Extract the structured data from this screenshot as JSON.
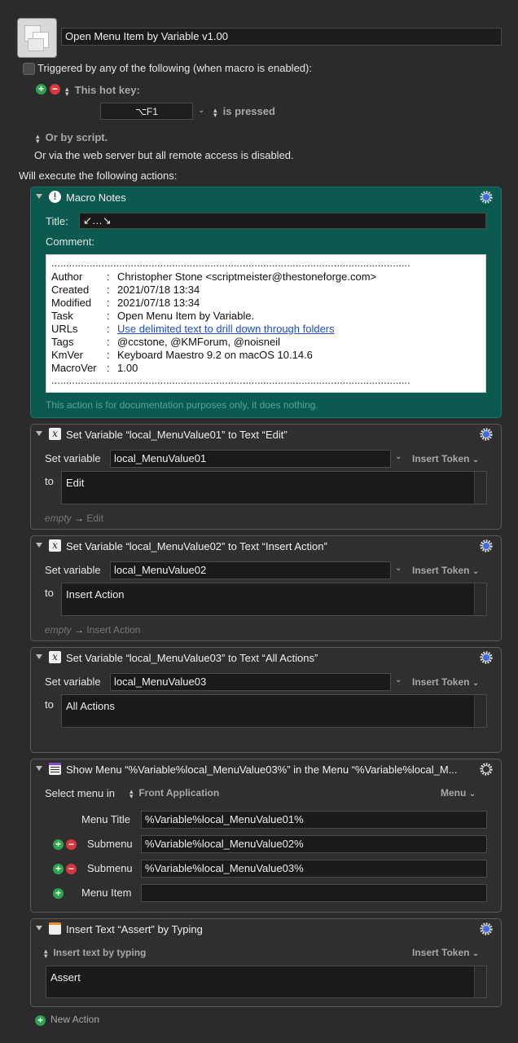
{
  "macro": {
    "name": "Open Menu Item by Variable v1.00",
    "trigger_checkbox_label": "Triggered by any of the following (when macro is enabled):",
    "hotkey_label": "This hot key:",
    "hotkey_value": "⌥F1",
    "hotkey_state": "is pressed",
    "or_by_script": "Or by script.",
    "web_server_note": "Or via the web server but all remote access is disabled.",
    "will_execute": "Will execute the following actions:",
    "new_action": "New Action"
  },
  "notes_action": {
    "title": "Macro Notes",
    "title_label": "Title:",
    "title_value": "↙…↘",
    "comment_label": "Comment:",
    "dots": "...............................................................................................................................................",
    "rows": [
      {
        "key": "Author",
        "value": "Christopher Stone <scriptmeister@thestoneforge.com>"
      },
      {
        "key": "Created",
        "value": "2021/07/18 13:34"
      },
      {
        "key": "Modified",
        "value": "2021/07/18 13:34"
      },
      {
        "key": "Task",
        "value": "Open Menu Item by Variable."
      },
      {
        "key": "URLs",
        "value": "Use delimited text to drill down through folders"
      },
      {
        "key": "Tags",
        "value": "@ccstone, @KMForum, @noisneil"
      },
      {
        "key": "KmVer",
        "value": "Keyboard Maestro 9.2 on macOS 10.14.6"
      },
      {
        "key": "MacroVer",
        "value": "1.00"
      }
    ],
    "footer": "This action is for documentation purposes only, it does nothing."
  },
  "set_var_actions": [
    {
      "title": "Set Variable “local_MenuValue01” to Text “Edit”",
      "set_label": "Set variable",
      "var_name": "local_MenuValue01",
      "insert_token": "Insert Token",
      "to_label": "to",
      "text": "Edit",
      "preview_empty": "empty",
      "preview_arrow": "→",
      "preview_value": "Edit"
    },
    {
      "title": "Set Variable “local_MenuValue02” to Text “Insert Action”",
      "set_label": "Set variable",
      "var_name": "local_MenuValue02",
      "insert_token": "Insert Token",
      "to_label": "to",
      "text": "Insert Action",
      "preview_empty": "empty",
      "preview_arrow": "→",
      "preview_value": "Insert Action"
    },
    {
      "title": "Set Variable “local_MenuValue03” to Text “All Actions”",
      "set_label": "Set variable",
      "var_name": "local_MenuValue03",
      "insert_token": "Insert Token",
      "to_label": "to",
      "text": "All Actions"
    }
  ],
  "show_menu_action": {
    "title": "Show Menu “%Variable%local_MenuValue03%” in the Menu “%Variable%local_M...",
    "select_label": "Select menu in",
    "app_value": "Front Application",
    "menu_popup": "Menu",
    "menu_title_label": "Menu Title",
    "menu_title_value": "%Variable%local_MenuValue01%",
    "submenu_label": "Submenu",
    "submenu1_value": "%Variable%local_MenuValue02%",
    "submenu2_value": "%Variable%local_MenuValue03%",
    "menu_item_label": "Menu Item",
    "menu_item_value": ""
  },
  "insert_text_action": {
    "title": "Insert Text “Assert” by Typing",
    "mode": "Insert text by typing",
    "insert_token": "Insert Token",
    "text": "Assert"
  },
  "colors": {
    "notes_bg": "#0b5a50",
    "link": "#1d4fc4",
    "plus": "#2da44e",
    "minus": "#d9363e",
    "gear": "#3b6ee6"
  }
}
